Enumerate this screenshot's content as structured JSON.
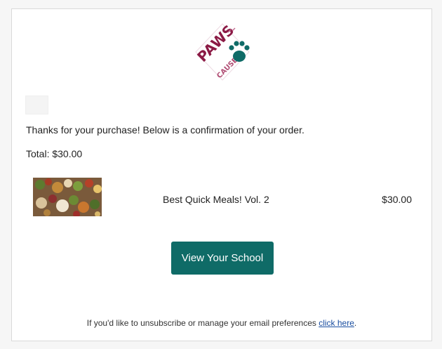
{
  "colors": {
    "accent_button": "#0f6b67",
    "logo_primary": "#8b1a45",
    "logo_paw": "#0f6b67",
    "link": "#1a4ea0"
  },
  "logo": {
    "label": "PAWS",
    "sublabel": "CAUSE",
    "icon": "paw-print-icon"
  },
  "message": {
    "intro": "Thanks for your purchase! Below is a confirmation of your order.",
    "total": "Total: $30.00"
  },
  "order": {
    "items": [
      {
        "name": "Best Quick Meals! Vol. 2",
        "price": "$30.00",
        "thumbnail": "food-spread-photo"
      }
    ]
  },
  "cta": {
    "label": "View Your School"
  },
  "footer": {
    "text": "If you'd like to unsubscribe or manage your email preferences ",
    "link_text": "click here",
    "suffix": "."
  }
}
